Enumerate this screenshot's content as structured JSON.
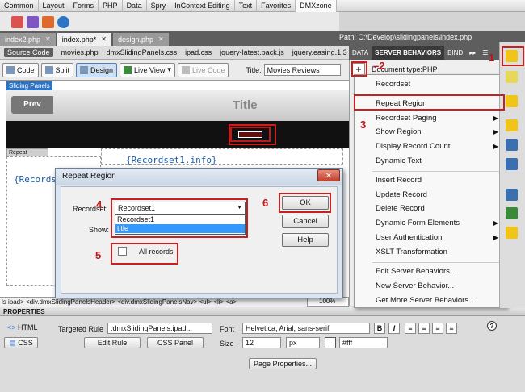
{
  "menubar": {
    "items": [
      "Common",
      "Layout",
      "Forms",
      "PHP",
      "Data",
      "Spry",
      "InContext Editing",
      "Text",
      "Favorites",
      "DMXzone"
    ],
    "active": "DMXzone"
  },
  "tabs": [
    {
      "label": "index2.php"
    },
    {
      "label": "index.php*"
    },
    {
      "label": "design.php"
    }
  ],
  "path": "Path:  C:\\Develop\\slidingpanels\\index.php",
  "related_files": [
    "Source Code",
    "movies.php",
    "dmxSlidingPanels.css",
    "ipad.css",
    "jquery-latest.pack.js",
    "jquery.easing.1.3"
  ],
  "viewbar": {
    "code": "Code",
    "split": "Split",
    "design": "Design",
    "live_view": "Live View",
    "live_code": "Live Code",
    "title_label": "Title:",
    "title_value": "Movies Reviews"
  },
  "design": {
    "spry_tag": "Sliding Panels",
    "prev": "Prev",
    "page_title": "Title",
    "repeat_tag": "Repeat",
    "recordset_info": "{Recordset1.info}",
    "recordset_left": "{Recordse"
  },
  "statusbar": {
    "path": "ls ipad> <div.dmxSlidingPanelsHeader> <div.dmxSlidingPanelsNav> <ul> <li> <a>",
    "zoom": "100%"
  },
  "panel": {
    "tabs": [
      "DATA",
      "SERVER BEHAVIORS",
      "BIND"
    ],
    "doctype": "Document type:PHP",
    "menu": [
      {
        "label": "Recordset",
        "arrow": false
      },
      {
        "label": "Repeat Region",
        "arrow": false
      },
      {
        "label": "Recordset Paging",
        "arrow": true
      },
      {
        "label": "Show Region",
        "arrow": true
      },
      {
        "label": "Display Record Count",
        "arrow": true
      },
      {
        "label": "Dynamic Text",
        "arrow": false
      },
      {
        "label": "Insert Record",
        "arrow": false
      },
      {
        "label": "Update Record",
        "arrow": false
      },
      {
        "label": "Delete Record",
        "arrow": false
      },
      {
        "label": "Dynamic Form Elements",
        "arrow": true
      },
      {
        "label": "User Authentication",
        "arrow": true
      },
      {
        "label": "XSLT Transformation",
        "arrow": false
      },
      {
        "label": "Edit Server Behaviors...",
        "arrow": false
      },
      {
        "label": "New Server Behavior...",
        "arrow": false
      },
      {
        "label": "Get More Server Behaviors...",
        "arrow": false
      }
    ]
  },
  "dialog": {
    "title": "Repeat Region",
    "recordset_label": "Recordset:",
    "recordset_value": "Recordset1",
    "options": [
      "Recordset1",
      "title"
    ],
    "show_label": "Show:",
    "all_records": "All records",
    "ok": "OK",
    "cancel": "Cancel",
    "help": "Help"
  },
  "properties": {
    "header": "PROPERTIES",
    "html": "HTML",
    "css": "CSS",
    "targeted_rule_label": "Targeted Rule",
    "targeted_rule_value": ".dmxSlidingPanels.ipad...",
    "edit_rule": "Edit Rule",
    "css_panel": "CSS Panel",
    "font_label": "Font",
    "font_value": "Helvetica, Arial, sans-serif",
    "size_label": "Size",
    "size_value": "12",
    "unit_value": "px",
    "color_value": "#fff",
    "page_properties": "Page Properties...",
    "bold": "B",
    "italic": "I"
  },
  "annotations": {
    "n1": "1",
    "n2": "2",
    "n3": "3",
    "n4": "4",
    "n5": "5",
    "n6": "6",
    "dash": "–"
  },
  "colors": {
    "annotation_red": "#c82020",
    "panel_dark": "#5e5e5e",
    "selection_blue": "#3399ff"
  }
}
